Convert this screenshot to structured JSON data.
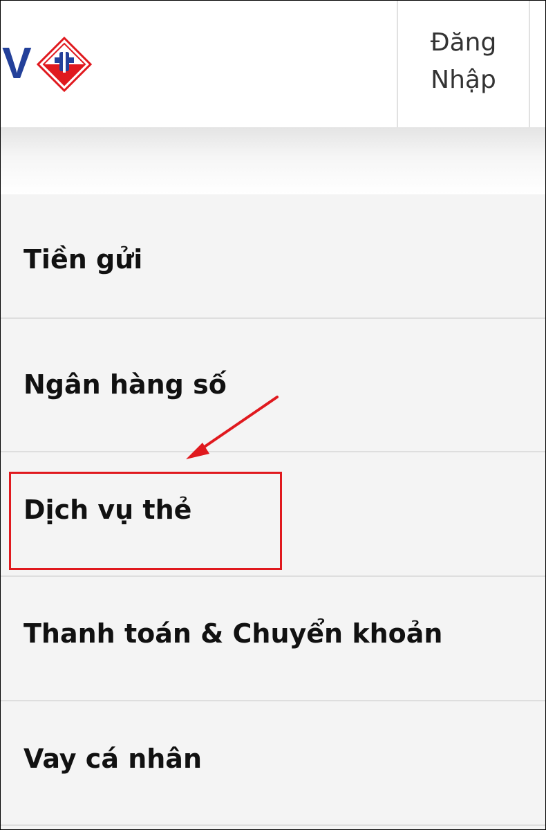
{
  "header": {
    "logo_text": "V",
    "login": {
      "line1": "Đăng",
      "line2": "Nhập"
    }
  },
  "menu": {
    "items": [
      {
        "label": "Tiền gửi"
      },
      {
        "label": "Ngân hàng số"
      },
      {
        "label": "Dịch vụ thẻ"
      },
      {
        "label": "Thanh toán & Chuyển khoản"
      },
      {
        "label": "Vay cá nhân"
      }
    ]
  },
  "colors": {
    "brand_blue": "#23409a",
    "brand_red": "#e0191e",
    "annotation_red": "#e0191e",
    "menu_bg": "#f4f4f4"
  },
  "icons": [
    "bank-logo-icon",
    "arrow-annotation-icon"
  ]
}
